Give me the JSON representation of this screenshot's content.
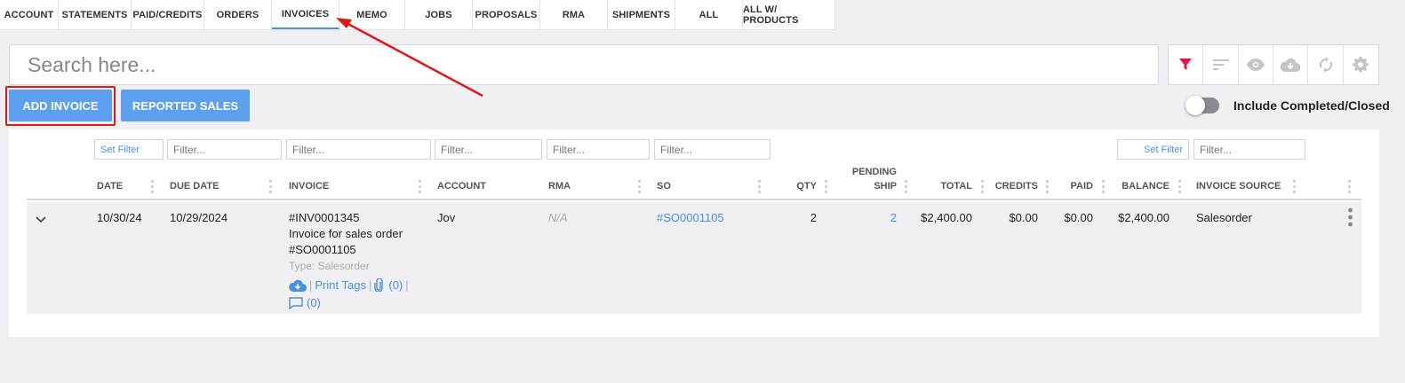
{
  "tabs": [
    {
      "label": "ACCOUNT",
      "w": 66
    },
    {
      "label": "STATEMENTS",
      "w": 82
    },
    {
      "label": "PAID/CREDITS",
      "w": 82
    },
    {
      "label": "ORDERS",
      "w": 76
    },
    {
      "label": "INVOICES",
      "w": 76
    },
    {
      "label": "MEMO",
      "w": 74
    },
    {
      "label": "JOBS",
      "w": 76
    },
    {
      "label": "PROPOSALS",
      "w": 76
    },
    {
      "label": "RMA",
      "w": 76
    },
    {
      "label": "SHIPMENTS",
      "w": 76
    },
    {
      "label": "ALL",
      "w": 76
    },
    {
      "label": "ALL W/ PRODUCTS",
      "w": 104
    }
  ],
  "active_tab": "INVOICES",
  "search": {
    "placeholder": "Search here..."
  },
  "toolbar": {
    "icons": [
      "filter-icon",
      "sort-icon",
      "eye-icon",
      "cloud-download-icon",
      "sync-icon",
      "gear-icon"
    ],
    "accent": "#e8163c",
    "muted": "#c4c4ca"
  },
  "buttons": {
    "add_invoice": "ADD INVOICE",
    "reported_sales": "REPORTED SALES"
  },
  "toggle": {
    "label": "Include Completed/Closed",
    "on": false
  },
  "filters": {
    "set_filter": "Set Filter",
    "placeholder": "Filter..."
  },
  "columns": {
    "date": "DATE",
    "due_date": "DUE DATE",
    "invoice": "INVOICE",
    "account": "ACCOUNT",
    "rma": "RMA",
    "so": "SO",
    "qty": "QTY",
    "pending_ship_1": "PENDING",
    "pending_ship_2": "SHIP",
    "total": "TOTAL",
    "credits": "CREDITS",
    "paid": "PAID",
    "balance": "BALANCE",
    "invoice_source": "INVOICE SOURCE"
  },
  "row": {
    "date": "10/30/24",
    "due_date": "10/29/2024",
    "invoice_number": "#INV0001345",
    "invoice_desc_1": "Invoice for sales order",
    "invoice_desc_2": "#SO0001105",
    "invoice_type": "Type: Salesorder",
    "account": "Jov",
    "rma": "N/A",
    "so": "#SO0001105",
    "qty": "2",
    "pending_ship": "2",
    "total": "$2,400.00",
    "credits": "$0.00",
    "paid": "$0.00",
    "balance": "$2,400.00",
    "invoice_source": "Salesorder",
    "print_tags": "Print Tags",
    "attachments": "(0)",
    "comments": "(0)"
  },
  "colors": {
    "accent": "#5ca0ef",
    "link": "#4a90e2",
    "highlight": "#e01818"
  }
}
